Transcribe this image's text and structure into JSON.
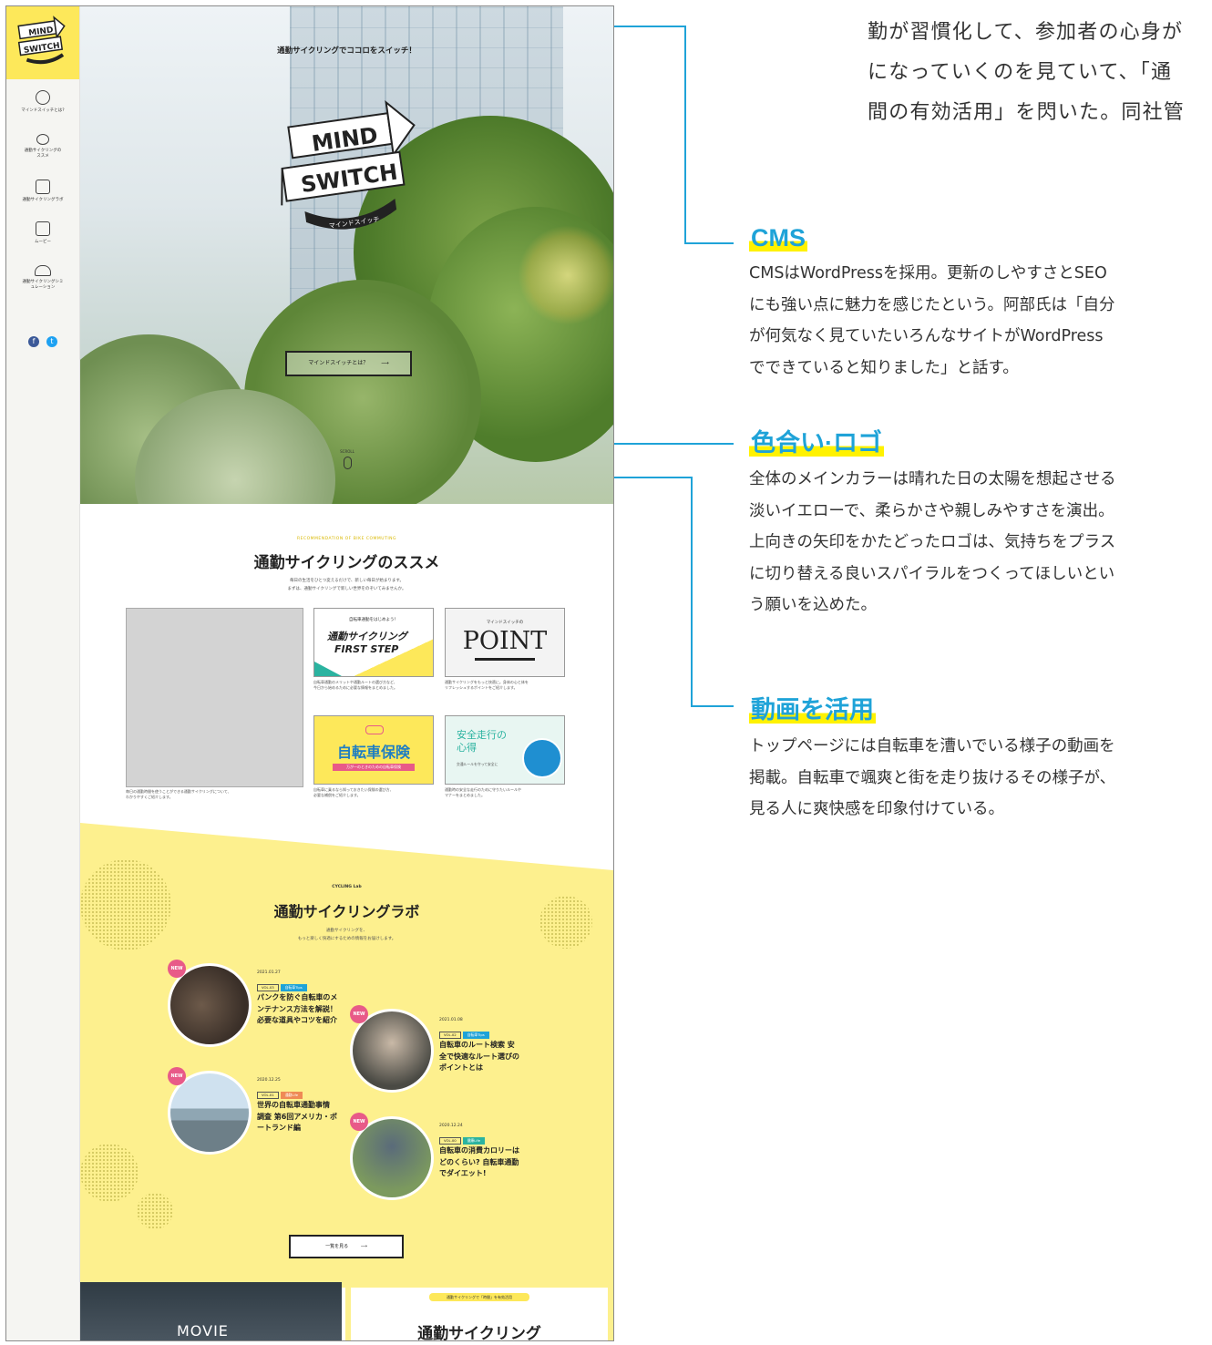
{
  "top_text": {
    "lines": [
      "勤が習慣化して、参加者の心身が",
      "になっていくのを見ていて、「通",
      "間の有効活用」を閃いた。同社管"
    ]
  },
  "annotations": [
    {
      "heading": "CMS",
      "lines": [
        "CMSはWordPressを採用。更新のしやすさとSEO",
        "にも強い点に魅力を感じたという。阿部氏は「自分",
        "が何気なく見ていたいろんなサイトがWordPress",
        "でできていると知りました」と話す。"
      ]
    },
    {
      "heading": "色合い·ロゴ",
      "lines": [
        "全体のメインカラーは晴れた日の太陽を想起させる",
        "淡いイエローで、柔らかさや親しみやすさを演出。",
        "上向きの矢印をかたどったロゴは、気持ちをプラス",
        "に切り替える良いスパイラルをつくってほしいとい",
        "う願いを込めた。"
      ]
    },
    {
      "heading": "動画を活用",
      "lines": [
        "トップページには自転車を漕いでいる様子の動画を",
        "掲載。自転車で颯爽と街を走り抜けるその様子が、",
        "見る人に爽快感を印象付けている。"
      ]
    }
  ],
  "site": {
    "brand_logo": {
      "line1": "MIND",
      "line2": "SWITCH"
    },
    "sidebar_nav": [
      {
        "icon": "bike-icon",
        "label": "マインドスイッチとは?"
      },
      {
        "icon": "bicycle-icon",
        "label": "通勤サイクリングのススメ"
      },
      {
        "icon": "notebook-icon",
        "label": "通勤サイクリングラボ"
      },
      {
        "icon": "play-icon",
        "label": "ムービー"
      },
      {
        "icon": "helmet-icon",
        "label": "通勤サイクリングシミュレーション"
      }
    ],
    "sns": {
      "facebook": "f",
      "twitter": "t"
    },
    "hero": {
      "tagline": "通勤サイクリングでココロをスイッチ！",
      "logo_line1": "MIND",
      "logo_line2": "SWITCH",
      "logo_sub": "マインドスイッチ",
      "button": "マインドスイッチとは？",
      "scroll": "SCROLL"
    },
    "recommend": {
      "eyebrow": "RECOMMENDATION OF BIKE COMMUTING",
      "title": "通勤サイクリングのススメ",
      "desc_lines": [
        "毎日の生活をひとつ変えるだけで、新しい毎日が始まります。",
        "まずは、通勤サイクリングで新しい世界をのぞいてみませんか。"
      ],
      "video_caption": [
        "毎日の通勤時間を使うことができる通勤サイクリングについて、",
        "わかりやすくご紹介します。"
      ],
      "cards": [
        {
          "pre": "自転車通勤をはじめよう！",
          "title": "通勤サイクリング",
          "title2": "FIRST STEP",
          "caption": [
            "自転車通勤のメリットや通勤ルートの選び方など、",
            "今日から始めるために必要な情報をまとめました。"
          ]
        },
        {
          "pre": "マインドスイッチの",
          "title": "POINT",
          "caption": [
            "通勤サイクリングをもっと快適に。身体の心と体を",
            "リフレッシュするポイントをご紹介します。"
          ]
        },
        {
          "title": "自転車保険",
          "sub": "万が一のときのための自転車保険",
          "caption": [
            "自転車に乗るなら知っておきたい保険の選び方、",
            "必要な補償をご紹介します。"
          ]
        },
        {
          "title": "安全走行の心得",
          "sub": "交通ルールを守って安全に",
          "caption": [
            "通勤時の安全な走行のために守りたいルールや",
            "マナーをまとめました。"
          ]
        }
      ]
    },
    "lab": {
      "eyebrow": "CYCLING Lab",
      "title": "通勤サイクリングラボ",
      "desc_lines": [
        "通勤サイクリングを、",
        "もっと楽しく快適にするための情報をお届けします。"
      ],
      "posts": [
        {
          "badge": "NEW",
          "date": "2021.01.27",
          "tags": [
            "VOL.03",
            "自転車Tips"
          ],
          "title": "パンクを防ぐ自転車のメンテナンス方法を解説！必要な道具やコツを紹介"
        },
        {
          "badge": "NEW",
          "date": "2021.01.08",
          "tags": [
            "VOL.02",
            "自転車Tips"
          ],
          "title": "自転車のルート検索 安全で快適なルート選びのポイントとは"
        },
        {
          "badge": "NEW",
          "date": "2020.12.25",
          "tags": [
            "VOL.01",
            "通勤Life"
          ],
          "title": "世界の自転車通勤事情 調査 第6回アメリカ・ポートランド編"
        },
        {
          "badge": "NEW",
          "date": "2020.12.24",
          "tags": [
            "VOL.00",
            "健康Life"
          ],
          "title": "自転車の消費カロリーはどのくらい? 自転車通勤でダイエット!"
        }
      ],
      "more_button": "一覧を見る"
    },
    "bottom": {
      "movie": "MOVIE",
      "tag": "通勤サイクリングで「時間」を有効活用",
      "title": "通勤サイクリング"
    }
  },
  "colors": {
    "accent": "#1fa3d8",
    "highlight": "#fff200",
    "brand_yellow": "#fde85a",
    "lab_yellow": "#fdf08e",
    "new_badge": "#e85a88"
  }
}
